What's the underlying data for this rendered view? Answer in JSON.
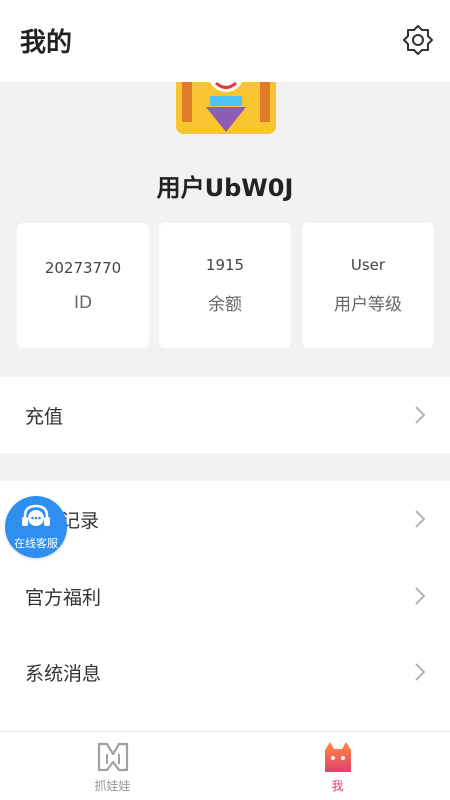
{
  "header": {
    "title": "我的"
  },
  "profile": {
    "username": "用户UbW0J"
  },
  "stats": [
    {
      "value": "20273770",
      "label": "ID"
    },
    {
      "value": "1915",
      "label": "余额"
    },
    {
      "value": "User",
      "label": "用户等级"
    }
  ],
  "menu": {
    "recharge": "充值",
    "records": "记录",
    "welfare": "官方福利",
    "messages": "系统消息"
  },
  "support": {
    "label": "在线客服"
  },
  "tabs": [
    {
      "label": "抓娃娃",
      "color": "#999999"
    },
    {
      "label": "我",
      "color": "#e0406e"
    }
  ],
  "colors": {
    "accent": "#e0406e",
    "support": "#2e8ff0",
    "background": "#f2f2f2"
  }
}
